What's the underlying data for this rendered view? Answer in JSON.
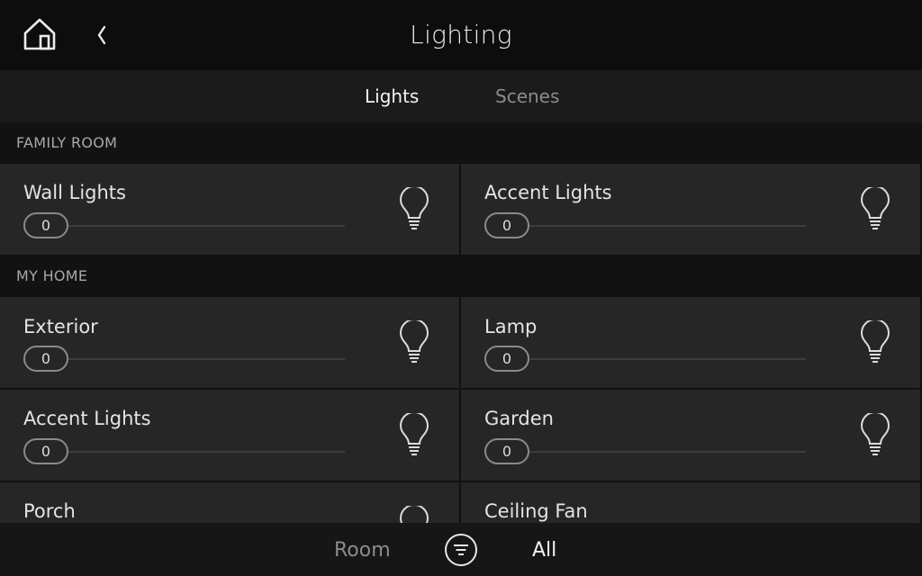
{
  "header": {
    "title": "Lighting",
    "home_icon": "home-icon",
    "back_icon": "chevron-left-icon"
  },
  "tabs": [
    {
      "label": "Lights",
      "active": true
    },
    {
      "label": "Scenes",
      "active": false
    }
  ],
  "sections": [
    {
      "title": "FAMILY ROOM",
      "tiles": [
        {
          "name": "Wall Lights",
          "level": "0",
          "icon": "lightbulb-icon"
        },
        {
          "name": "Accent Lights",
          "level": "0",
          "icon": "lightbulb-icon"
        }
      ]
    },
    {
      "title": "MY HOME",
      "tiles": [
        {
          "name": "Exterior",
          "level": "0",
          "icon": "lightbulb-icon"
        },
        {
          "name": "Lamp",
          "level": "0",
          "icon": "lightbulb-icon"
        },
        {
          "name": "Accent Lights",
          "level": "0",
          "icon": "lightbulb-icon"
        },
        {
          "name": "Garden",
          "level": "0",
          "icon": "lightbulb-icon"
        },
        {
          "name": "Porch",
          "icon": "lightbulb-icon"
        },
        {
          "name": "Ceiling Fan",
          "icon": "fan-icon"
        }
      ]
    }
  ],
  "bottom_nav": {
    "room_label": "Room",
    "filter_icon": "filter-icon",
    "all_label": "All"
  },
  "colors": {
    "background": "#111111",
    "tile": "#262626",
    "header": "#0d0d0d",
    "text": "#e6e6e6",
    "muted": "#8c8c8c"
  }
}
